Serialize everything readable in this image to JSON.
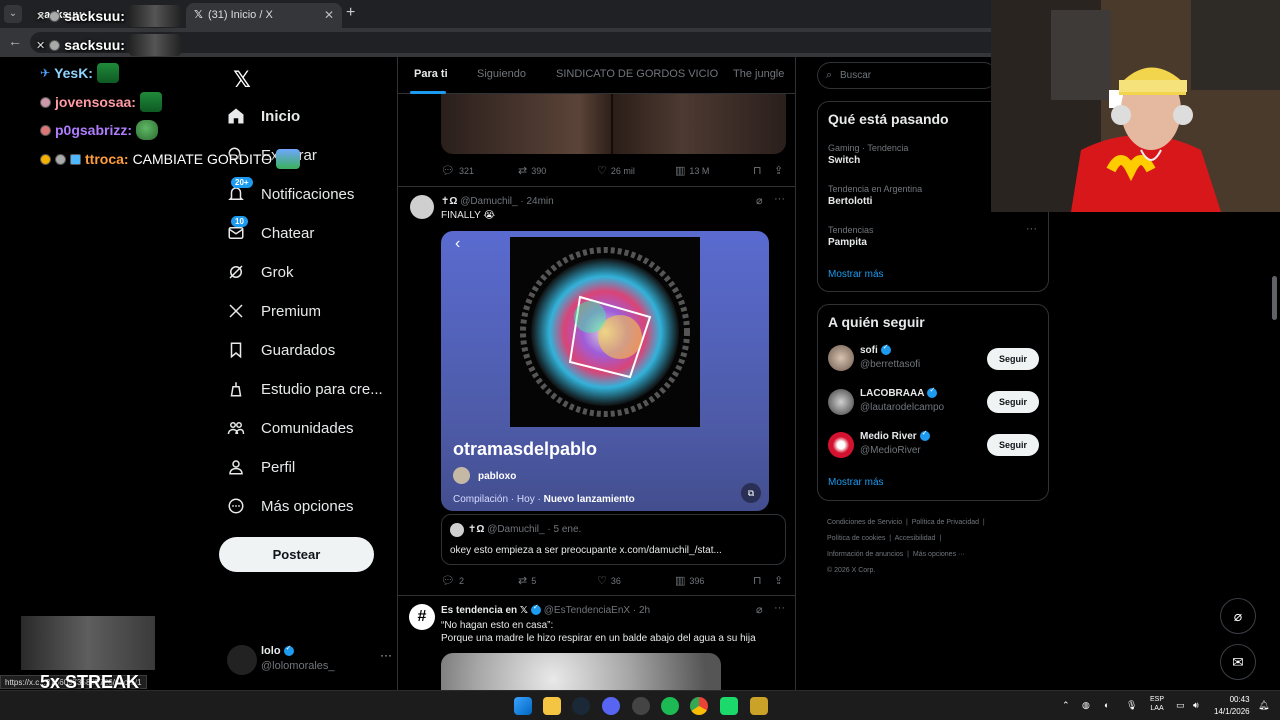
{
  "browser": {
    "tabs": [
      {
        "label": "sacksuu:",
        "active": false
      },
      {
        "label": "(31) Inicio / X",
        "active": true
      }
    ],
    "new_tab": "+",
    "status_url": "https://x.c...276609735835726/photo/1"
  },
  "overlay": {
    "chat": [
      {
        "user": "sacksuu:",
        "message": ""
      },
      {
        "user": "sacksuu:",
        "message": ""
      },
      {
        "user": "YesK:",
        "message": ""
      },
      {
        "user": "jovensosaa:",
        "message": ""
      },
      {
        "user": "p0gsabrizz:",
        "message": ""
      },
      {
        "user": "ttroca:",
        "message": "CAMBIATE GORDITO"
      }
    ],
    "streak": "5x STREAK"
  },
  "nav": {
    "items": [
      {
        "label": "Inicio",
        "icon": "home-icon",
        "active": true
      },
      {
        "label": "Explorar",
        "icon": "search-icon"
      },
      {
        "label": "Notificaciones",
        "icon": "bell-icon",
        "badge": "20+"
      },
      {
        "label": "Chatear",
        "icon": "mail-icon",
        "badge": "10"
      },
      {
        "label": "Grok",
        "icon": "grok-icon"
      },
      {
        "label": "Premium",
        "icon": "x-icon"
      },
      {
        "label": "Guardados",
        "icon": "bookmark-icon"
      },
      {
        "label": "Estudio para cre...",
        "icon": "studio-icon"
      },
      {
        "label": "Comunidades",
        "icon": "communities-icon"
      },
      {
        "label": "Perfil",
        "icon": "profile-icon"
      },
      {
        "label": "Más opciones",
        "icon": "more-icon"
      }
    ],
    "post_button": "Postear",
    "account": {
      "name": "lolo",
      "handle": "@lolomorales_"
    }
  },
  "timeline": {
    "tabs": [
      "Para ti",
      "Siguiendo",
      "SINDICATO DE GORDOS VICIO",
      "The jungle"
    ],
    "top_actions": {
      "replies": "321",
      "reposts": "390",
      "likes": "26 mil",
      "views": "13 M"
    },
    "tweet1": {
      "name": "✝Ω",
      "handle": "@Damuchil_",
      "time": "· 24min",
      "text": "FINALLY 😭",
      "card": {
        "title": "otramasdelpablo",
        "author": "pabloxo",
        "meta_prefix": "Compilación · Hoy · ",
        "meta_bold": "Nuevo lanzamiento"
      },
      "quote": {
        "name": "✝Ω",
        "handle": "@Damuchil_",
        "time": "· 5 ene.",
        "text": "okey esto empieza a ser preocupante x.com/damuchil_/stat..."
      },
      "actions": {
        "replies": "2",
        "reposts": "5",
        "likes": "36",
        "views": "396"
      }
    },
    "tweet2": {
      "name": "Es tendencia en 𝕏",
      "handle": "@EsTendenciaEnX",
      "time": "· 2h",
      "line1": "“No hagan esto en casa”:",
      "line2": "Porque una madre le hizo respirar en un balde abajo del agua a su hija"
    }
  },
  "sidebar": {
    "search_placeholder": "Buscar",
    "trends_title": "Qué está pasando",
    "trends": [
      {
        "meta": "Gaming · Tendencia",
        "name": "Switch"
      },
      {
        "meta": "Tendencia en Argentina",
        "name": "Bertolotti"
      },
      {
        "meta": "Tendencias",
        "name": "Pampita"
      }
    ],
    "trends_more": "Mostrar más",
    "who_title": "A quién seguir",
    "who": [
      {
        "name": "sofi",
        "handle": "@berrettasofi",
        "button": "Seguir"
      },
      {
        "name": "LACOBRAAA",
        "handle": "@lautarodelcampo",
        "button": "Seguir"
      },
      {
        "name": "Medio River",
        "handle": "@MedioRiver",
        "button": "Seguir"
      }
    ],
    "who_more": "Mostrar más",
    "footer": [
      "Condiciones de Servicio",
      "Política de Privacidad",
      "Política de cookies",
      "Accesibilidad",
      "Información de anuncios",
      "Más opciones ···",
      "© 2026 X Corp."
    ]
  },
  "taskbar": {
    "lang1": "ESP",
    "lang2": "LAA",
    "time": "00:43",
    "date": "14/1/2026"
  },
  "colors": {
    "accent": "#1d9bf0",
    "background": "#000000",
    "border": "#2f3336"
  }
}
